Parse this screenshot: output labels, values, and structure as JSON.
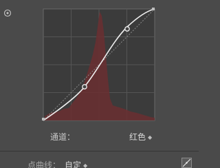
{
  "curve": {
    "channel_label": "通道：",
    "channel_value": "红色",
    "point_curve_label": "点曲线：",
    "point_curve_value": "自定",
    "points": [
      {
        "input": 0,
        "output": 0
      },
      {
        "input": 0.37,
        "output": 0.3
      },
      {
        "input": 0.75,
        "output": 0.82
      },
      {
        "input": 1,
        "output": 1
      }
    ]
  },
  "icons": {
    "target": "target-adjustment-icon",
    "select_arrow": "up-down-arrow-icon",
    "edit_curve": "edit-point-curve-icon"
  },
  "colors": {
    "panel_background": "#4a4a4a",
    "graph_background": "#3b3b3b",
    "histogram": "#6a2e31",
    "curve": "#efefef",
    "grid": "#555555"
  }
}
